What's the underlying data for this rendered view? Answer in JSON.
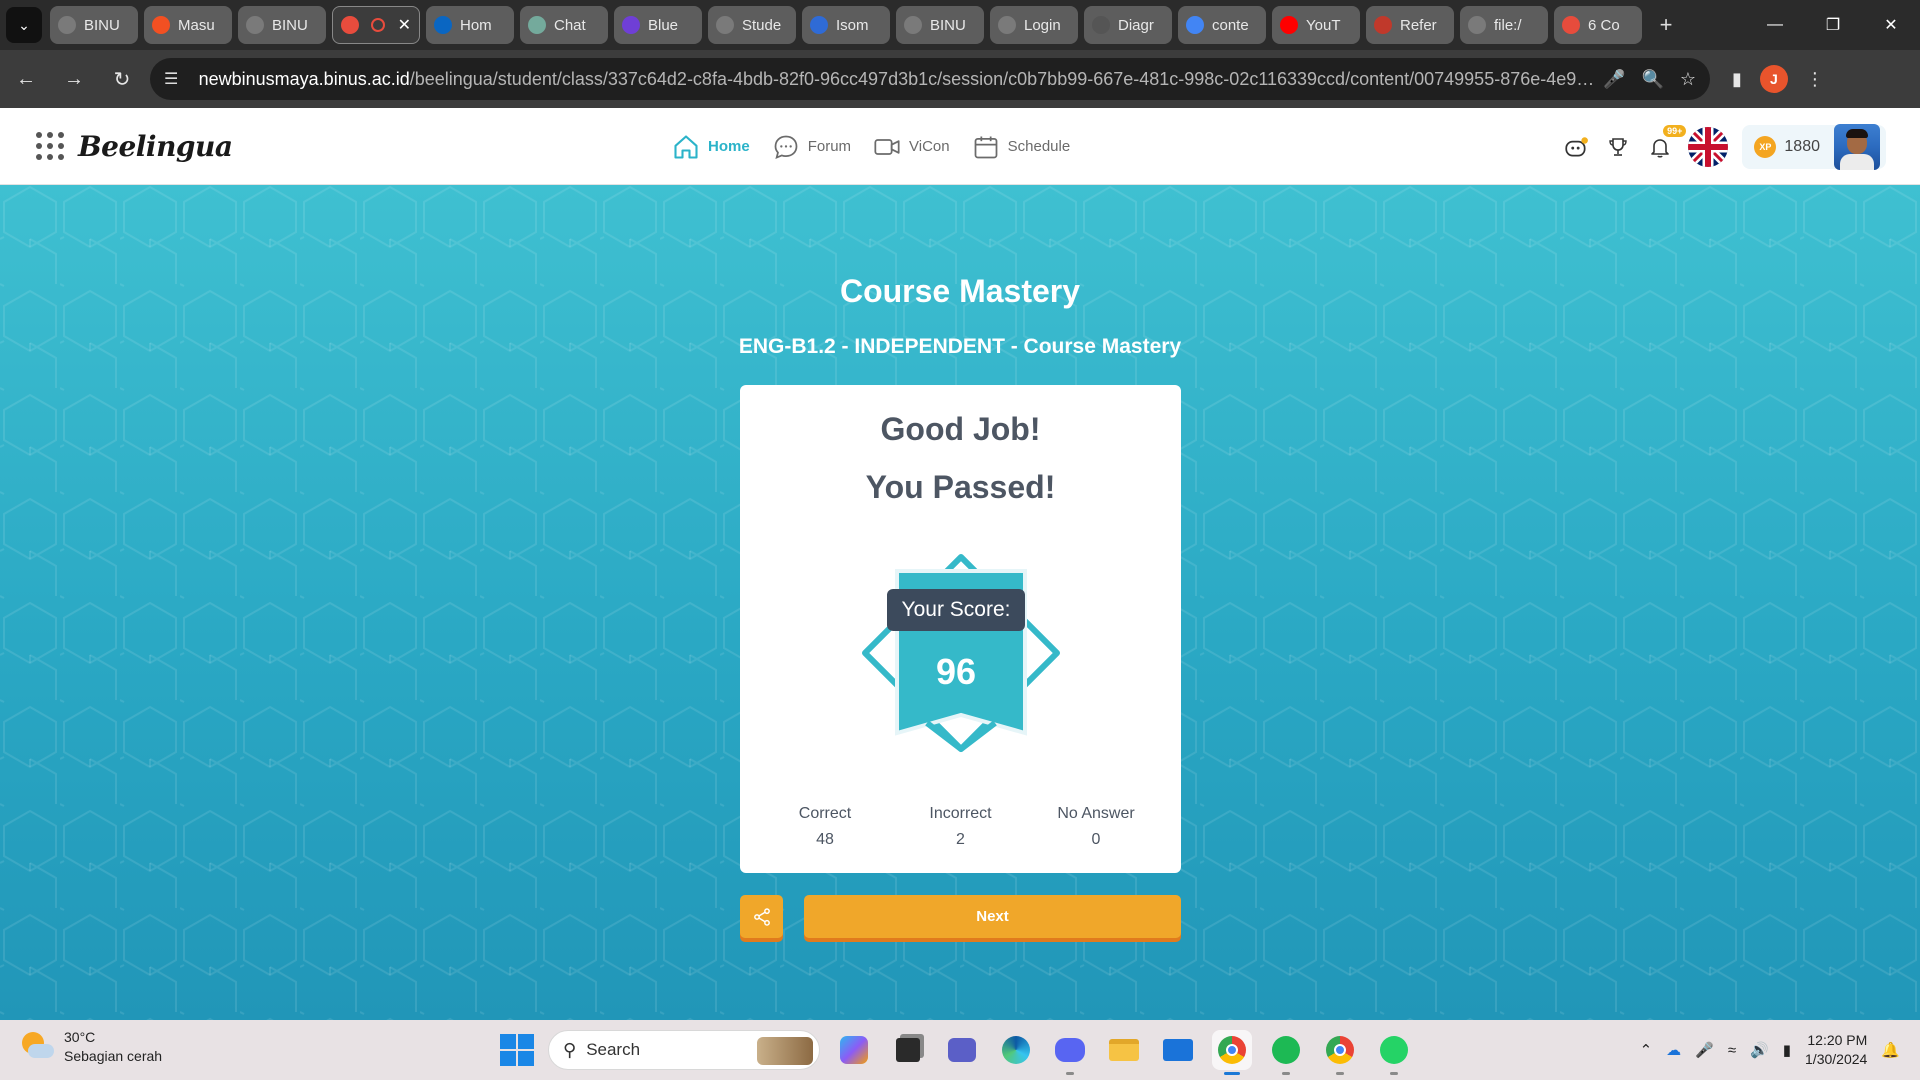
{
  "browser": {
    "tabs": [
      {
        "label": "BINU",
        "favicon_color": "#7a7a7a",
        "active": false
      },
      {
        "label": "Masu",
        "favicon_color": "#f25022",
        "active": false
      },
      {
        "label": "BINU",
        "favicon_color": "#7a7a7a",
        "active": false
      },
      {
        "label": "",
        "favicon_color": "#e84c3d",
        "active": true
      },
      {
        "label": "Hom",
        "favicon_color": "#0a66c2",
        "active": false
      },
      {
        "label": "Chat",
        "favicon_color": "#74aa9c",
        "active": false
      },
      {
        "label": "Blue",
        "favicon_color": "#6f3fd6",
        "active": false
      },
      {
        "label": "Stude",
        "favicon_color": "#7a7a7a",
        "active": false
      },
      {
        "label": "Isom",
        "favicon_color": "#2f6bd6",
        "active": false
      },
      {
        "label": "BINU",
        "favicon_color": "#7a7a7a",
        "active": false
      },
      {
        "label": "Login",
        "favicon_color": "#7a7a7a",
        "active": false
      },
      {
        "label": "Diagr",
        "favicon_color": "#555555",
        "active": false
      },
      {
        "label": "conte",
        "favicon_color": "#4285f4",
        "active": false
      },
      {
        "label": "YouT",
        "favicon_color": "#ff0000",
        "active": false
      },
      {
        "label": "Refer",
        "favicon_color": "#c0392b",
        "active": false
      },
      {
        "label": "file:/",
        "favicon_color": "#7a7a7a",
        "active": false
      },
      {
        "label": "6 Co",
        "favicon_color": "#e74c3c",
        "active": false
      }
    ],
    "url_host": "newbinusmaya.binus.ac.id",
    "url_path": "/beelingua/student/class/337c64d2-c8fa-4bdb-82f0-96cc497d3b1c/session/c0b7bb99-667e-481c-998c-02c116339ccd/content/00749955-876e-4e99-8451-0a6...",
    "profile_initial": "J"
  },
  "app": {
    "logo": "Beelingua",
    "nav": [
      {
        "label": "Home",
        "icon": "home-icon",
        "active": true
      },
      {
        "label": "Forum",
        "icon": "chat-bubble-icon",
        "active": false
      },
      {
        "label": "ViCon",
        "icon": "video-camera-icon",
        "active": false
      },
      {
        "label": "Schedule",
        "icon": "calendar-icon",
        "active": false
      }
    ],
    "notification_badge": "99+",
    "xp_label": "XP",
    "xp_value": "1880",
    "accent_color": "#2bb3c9"
  },
  "result": {
    "title": "Course Mastery",
    "subtitle": "ENG-B1.2 - INDEPENDENT - Course Mastery",
    "headline_1": "Good Job!",
    "headline_2": "You Passed!",
    "score_label": "Your Score:",
    "score": "96",
    "stats": [
      {
        "label": "Correct",
        "value": "48"
      },
      {
        "label": "Incorrect",
        "value": "2"
      },
      {
        "label": "No Answer",
        "value": "0"
      }
    ],
    "next_label": "Next",
    "button_color": "#f0a72a"
  },
  "taskbar": {
    "weather_temp": "30°C",
    "weather_desc": "Sebagian cerah",
    "search_placeholder": "Search",
    "apps": [
      "copilot-icon",
      "terminal-icon",
      "teams-icon",
      "edge-icon",
      "discord-icon",
      "file-explorer-icon",
      "mail-icon",
      "chrome-icon",
      "spotify-icon",
      "chrome-profile-icon",
      "whatsapp-icon"
    ],
    "time": "12:20 PM",
    "date": "1/30/2024"
  }
}
